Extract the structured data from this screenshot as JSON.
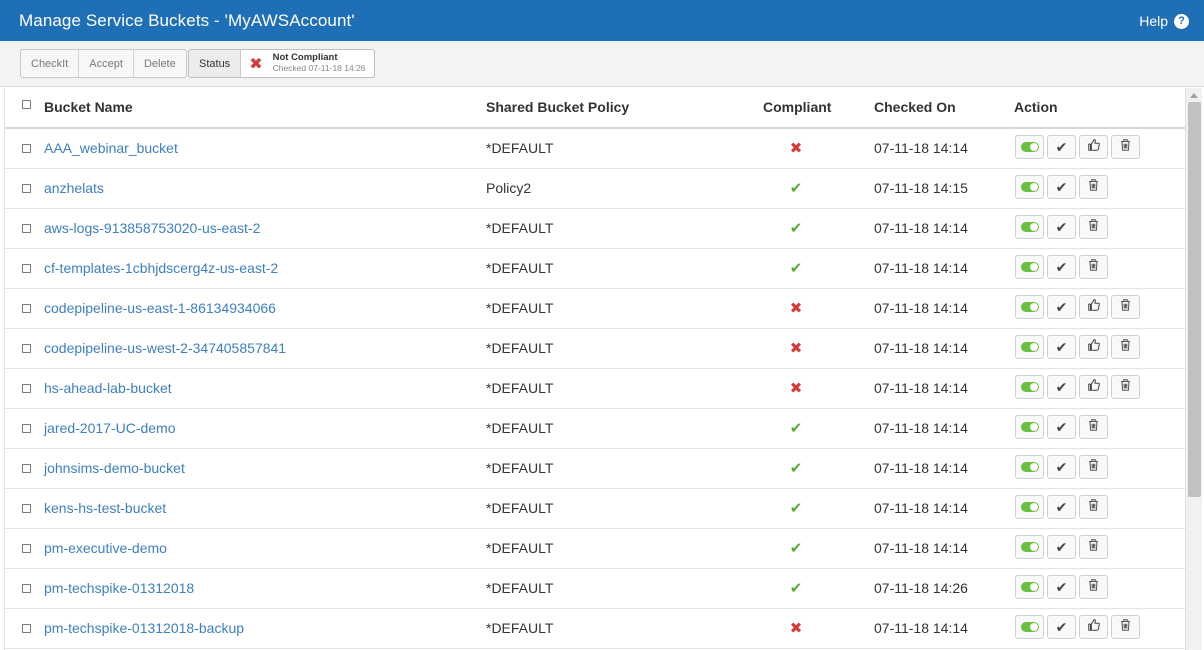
{
  "window": {
    "title": "Manage Service Buckets - 'MyAWSAccount'",
    "help_label": "Help",
    "help_icon": "question-circle-icon"
  },
  "toolbar": {
    "checkit_label": "CheckIt",
    "accept_label": "Accept",
    "delete_label": "Delete",
    "status_label": "Status",
    "status_main": "Not Compliant",
    "status_sub": "Checked 07-11-18 14:26"
  },
  "table": {
    "headers": {
      "bucket_name": "Bucket Name",
      "policy": "Shared Bucket Policy",
      "compliant": "Compliant",
      "checked_on": "Checked On",
      "action": "Action"
    },
    "rows": [
      {
        "name": "AAA_webinar_bucket",
        "policy": "*DEFAULT",
        "compliant": false,
        "checked_on": "07-11-18 14:14"
      },
      {
        "name": "anzhelats",
        "policy": "Policy2",
        "compliant": true,
        "checked_on": "07-11-18 14:15"
      },
      {
        "name": "aws-logs-913858753020-us-east-2",
        "policy": "*DEFAULT",
        "compliant": true,
        "checked_on": "07-11-18 14:14"
      },
      {
        "name": "cf-templates-1cbhjdscerg4z-us-east-2",
        "policy": "*DEFAULT",
        "compliant": true,
        "checked_on": "07-11-18 14:14"
      },
      {
        "name": "codepipeline-us-east-1-86134934066",
        "policy": "*DEFAULT",
        "compliant": false,
        "checked_on": "07-11-18 14:14"
      },
      {
        "name": "codepipeline-us-west-2-347405857841",
        "policy": "*DEFAULT",
        "compliant": false,
        "checked_on": "07-11-18 14:14"
      },
      {
        "name": "hs-ahead-lab-bucket",
        "policy": "*DEFAULT",
        "compliant": false,
        "checked_on": "07-11-18 14:14"
      },
      {
        "name": "jared-2017-UC-demo",
        "policy": "*DEFAULT",
        "compliant": true,
        "checked_on": "07-11-18 14:14"
      },
      {
        "name": "johnsims-demo-bucket",
        "policy": "*DEFAULT",
        "compliant": true,
        "checked_on": "07-11-18 14:14"
      },
      {
        "name": "kens-hs-test-bucket",
        "policy": "*DEFAULT",
        "compliant": true,
        "checked_on": "07-11-18 14:14"
      },
      {
        "name": "pm-executive-demo",
        "policy": "*DEFAULT",
        "compliant": true,
        "checked_on": "07-11-18 14:14"
      },
      {
        "name": "pm-techspike-01312018",
        "policy": "*DEFAULT",
        "compliant": true,
        "checked_on": "07-11-18 14:26"
      },
      {
        "name": "pm-techspike-01312018-backup",
        "policy": "*DEFAULT",
        "compliant": false,
        "checked_on": "07-11-18 14:14"
      }
    ]
  },
  "colors": {
    "titlebar": "#1f6fb6",
    "link": "#3d7fc1",
    "compliant_yes": "#5aab3b",
    "compliant_no": "#d63b3b",
    "toggle_on": "#6bbf3f"
  }
}
